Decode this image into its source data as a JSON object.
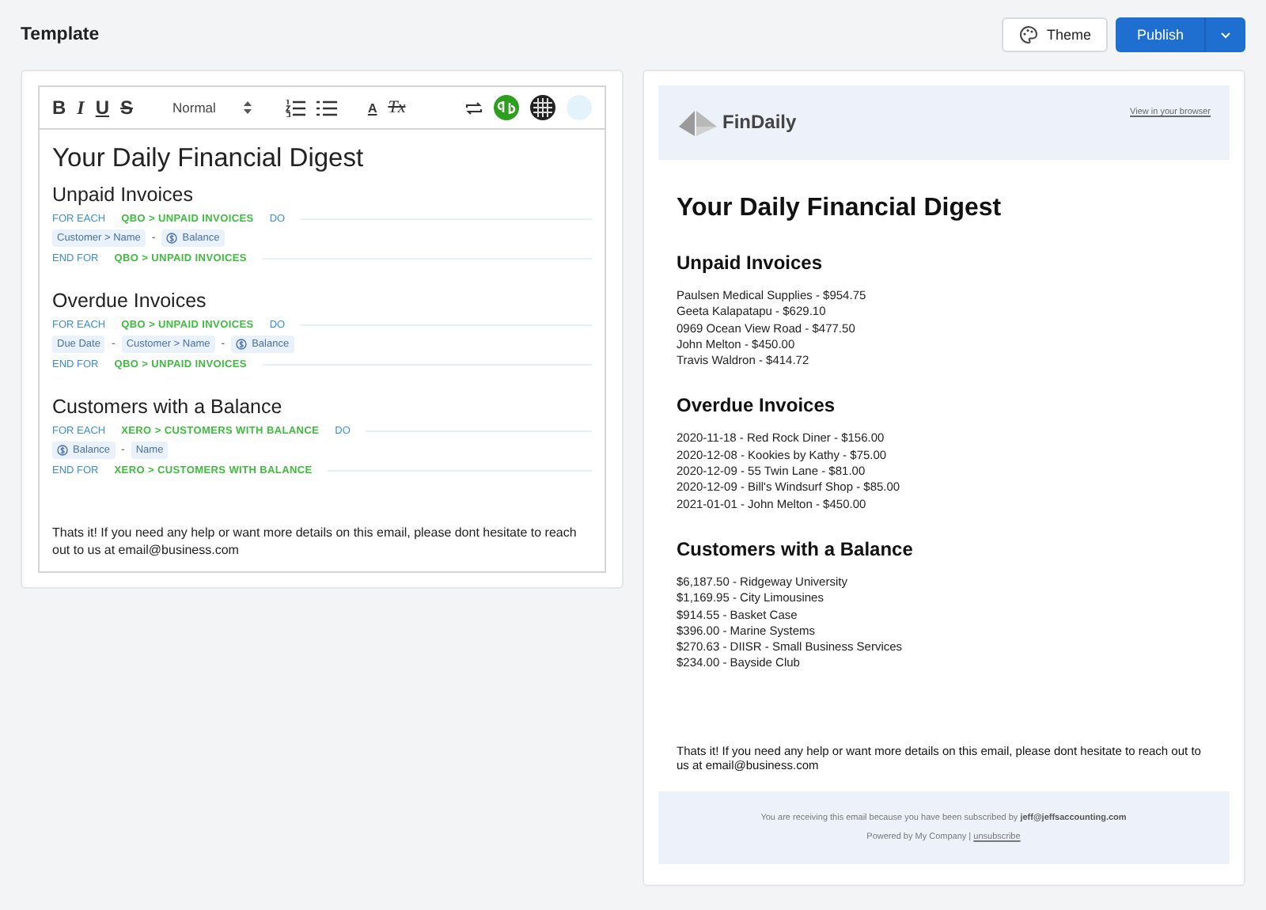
{
  "page_title": "Template",
  "actions": {
    "theme": "Theme",
    "publish": "Publish"
  },
  "toolbar": [
    {
      "kind": "bold",
      "label": "B"
    },
    {
      "kind": "italic",
      "label": "I"
    },
    {
      "kind": "underline",
      "label": "U"
    },
    {
      "kind": "strike",
      "label": "S"
    },
    {
      "kind": "select",
      "label": "Normal"
    },
    {
      "kind": "ordered-list"
    },
    {
      "kind": "bullet-list"
    },
    {
      "kind": "text-color",
      "label": "A"
    },
    {
      "kind": "clear-format",
      "label": "Tx"
    },
    {
      "kind": "sync"
    },
    {
      "kind": "qb"
    },
    {
      "kind": "grid-logo"
    },
    {
      "kind": "xero"
    }
  ],
  "editor": [
    {
      "kind": "h1",
      "text": "Your Daily Financial Digest"
    },
    {
      "kind": "h2",
      "text": "Unpaid Invoices"
    },
    {
      "kind": "for",
      "start": "FOR EACH",
      "source": "QBO > UNPAID INVOICES",
      "end": "DO"
    },
    {
      "kind": "fields",
      "separator": "-",
      "fields": [
        {
          "label": "Customer > Name",
          "currency": false
        },
        {
          "label": "Balance",
          "currency": true
        }
      ]
    },
    {
      "kind": "endfor",
      "start": "END FOR",
      "source": "QBO > UNPAID INVOICES"
    },
    {
      "kind": "h2",
      "text": "Overdue Invoices"
    },
    {
      "kind": "for",
      "start": "FOR EACH",
      "source": "QBO > UNPAID INVOICES",
      "end": "DO"
    },
    {
      "kind": "fields",
      "separator": "-",
      "fields": [
        {
          "label": "Due Date",
          "currency": false
        },
        {
          "label": "Customer > Name",
          "currency": false
        },
        {
          "label": "Balance",
          "currency": true
        }
      ]
    },
    {
      "kind": "endfor",
      "start": "END FOR",
      "source": "QBO > UNPAID INVOICES"
    },
    {
      "kind": "h2",
      "text": "Customers with a Balance"
    },
    {
      "kind": "for",
      "start": "FOR EACH",
      "source": "XERO > CUSTOMERS WITH BALANCE",
      "end": "DO"
    },
    {
      "kind": "fields",
      "separator": "-",
      "fields": [
        {
          "label": "Balance",
          "currency": true
        },
        {
          "label": "Name",
          "currency": false
        }
      ]
    },
    {
      "kind": "endfor",
      "start": "END FOR",
      "source": "XERO > CUSTOMERS WITH BALANCE"
    },
    {
      "kind": "para",
      "text": "Thats it! If you need any help or want more details on this email, please dont hesitate to reach out to us at email@business.com"
    }
  ],
  "preview": {
    "brand": "FinDaily",
    "view_link": "View in your browser",
    "title": "Your Daily Financial Digest",
    "sections": [
      {
        "heading": "Unpaid Invoices",
        "lines": [
          "Paulsen Medical Supplies - $954.75",
          "Geeta Kalapatapu - $629.10",
          "0969 Ocean View Road - $477.50",
          "John Melton - $450.00",
          "Travis Waldron - $414.72"
        ]
      },
      {
        "heading": "Overdue Invoices",
        "lines": [
          "2020-11-18 - Red Rock Diner - $156.00",
          "2020-12-08 - Kookies by Kathy - $75.00",
          "2020-12-09 - 55 Twin Lane - $81.00",
          "2020-12-09 - Bill's Windsurf Shop - $85.00",
          "2021-01-01 - John Melton - $450.00"
        ]
      },
      {
        "heading": "Customers with a Balance",
        "lines": [
          "$6,187.50 - Ridgeway University",
          "$1,169.95 - City Limousines",
          "$914.55 - Basket Case",
          "$396.00 - Marine Systems",
          "$270.63 - DIISR - Small Business Services",
          "$234.00 - Bayside Club"
        ]
      }
    ],
    "closing": "Thats it! If you need any help or want more details on this email, please dont hesitate to reach out to us at email@business.com",
    "footer_note": "You are receiving this email because you have been subscribed by **jeff@jeffsaccounting.com**",
    "powered": "Powered by My Company |",
    "unsubscribe": "unsubscribe"
  }
}
